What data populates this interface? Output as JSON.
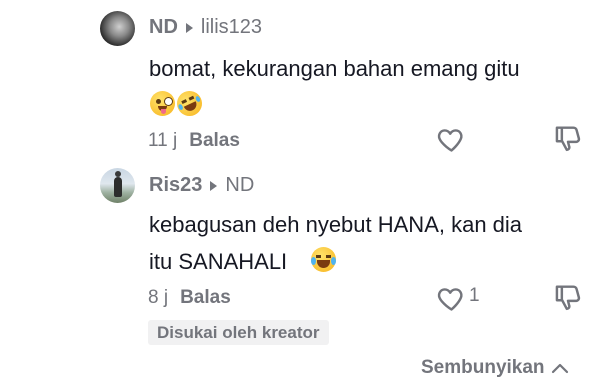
{
  "comments": [
    {
      "username": "ND",
      "reply_to": "lilis123",
      "text": "bomat, kekurangan bahan emang gitu",
      "emojis": [
        "zany-face-emoji",
        "rolling-laughing-emoji"
      ],
      "time": "11 j",
      "reply_label": "Balas",
      "like_count": ""
    },
    {
      "username": "Ris23",
      "reply_to": "ND",
      "text_line1": "kebagusan deh nyebut HANA, kan dia",
      "text_line2": "itu SANAHALI",
      "emojis": [
        "tears-of-joy-emoji"
      ],
      "time": "8 j",
      "reply_label": "Balas",
      "like_count": "1",
      "creator_badge": "Disukai oleh kreator"
    }
  ],
  "footer": {
    "hide_label": "Sembunyikan"
  },
  "colors": {
    "text_primary": "#161823",
    "text_secondary": "#73757c",
    "badge_bg": "#f1f1f2"
  }
}
